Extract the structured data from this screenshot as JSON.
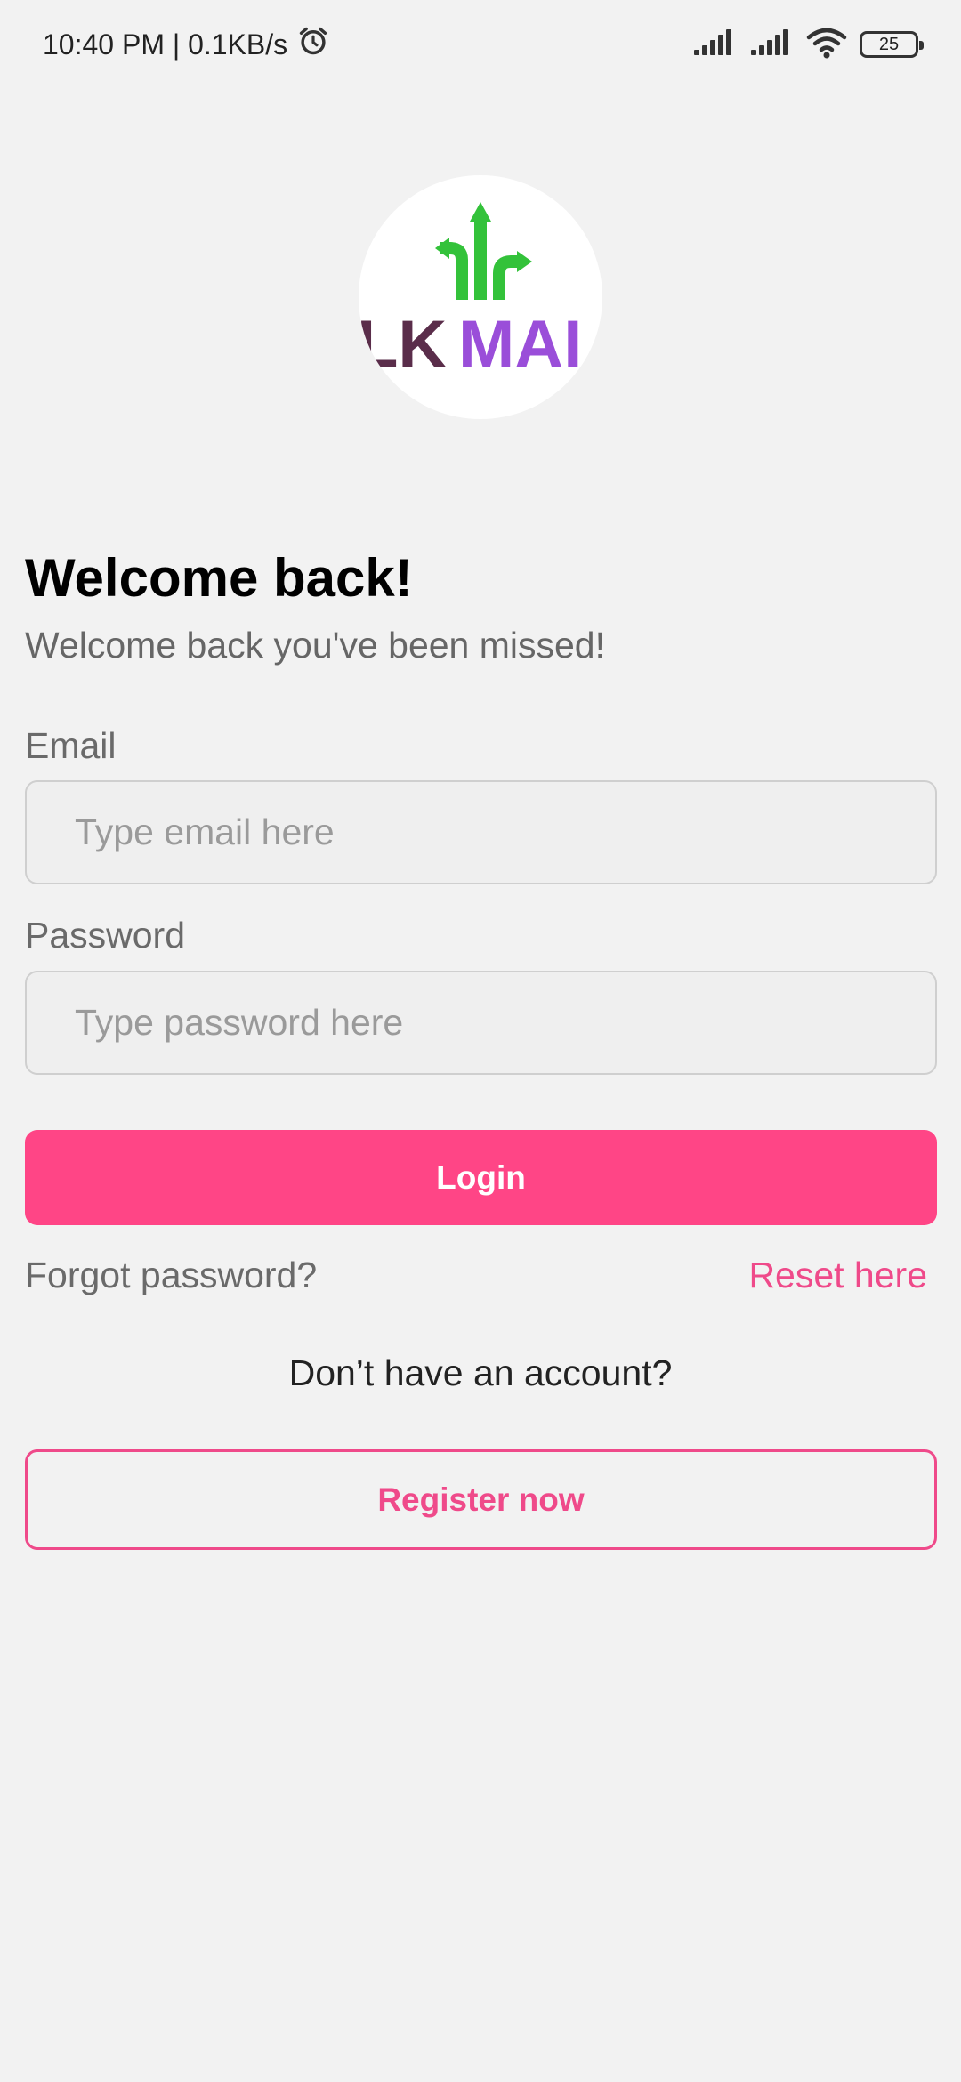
{
  "status_bar": {
    "time_speed": "10:40 PM | 0.1KB/s",
    "battery_level": "25",
    "icons": [
      "alarm-icon",
      "signal-icon",
      "signal-icon",
      "wifi-icon",
      "battery-icon"
    ]
  },
  "logo": {
    "text_dark": "LK",
    "text_accent": "MAI",
    "colors": {
      "arrows": "#33c23a",
      "dark": "#5a2d4a",
      "accent": "#9a4ed9"
    }
  },
  "header": {
    "title": "Welcome back!",
    "subtitle": "Welcome back you've been missed!"
  },
  "form": {
    "email_label": "Email",
    "email_placeholder": "Type email here",
    "email_value": "",
    "password_label": "Password",
    "password_placeholder": "Type password here",
    "password_value": "",
    "login_label": "Login"
  },
  "links": {
    "forgot_text": "Forgot password?",
    "reset_text": "Reset here",
    "no_account_text": "Don’t have an account?",
    "register_label": "Register now"
  },
  "colors": {
    "primary": "#ff4586",
    "accent_text": "#ef4a8a",
    "background": "#f2f2f2"
  }
}
